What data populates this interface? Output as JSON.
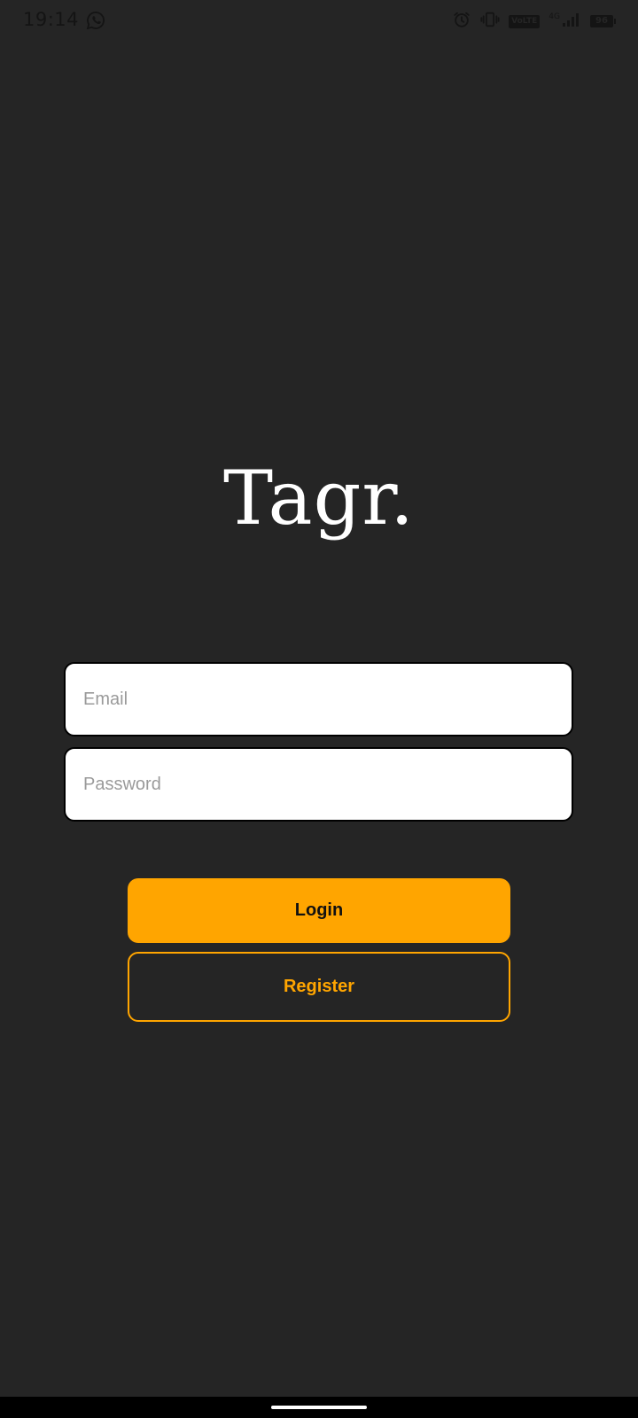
{
  "status_bar": {
    "time": "19:14",
    "volte_label": "VoLTE",
    "network_label": "4G",
    "battery_level": "96",
    "icons": [
      "whatsapp-icon",
      "alarm-icon",
      "vibrate-icon",
      "signal-icon",
      "battery-icon"
    ],
    "icon_color": "#141414"
  },
  "app": {
    "logo_text": "Tagr."
  },
  "form": {
    "email": {
      "placeholder": "Email",
      "value": ""
    },
    "password": {
      "placeholder": "Password",
      "value": ""
    }
  },
  "actions": {
    "login_label": "Login",
    "register_label": "Register"
  },
  "colors": {
    "background": "#252525",
    "accent": "#FFA500",
    "input_background": "#FFFFFF",
    "text_on_accent": "#111111"
  }
}
